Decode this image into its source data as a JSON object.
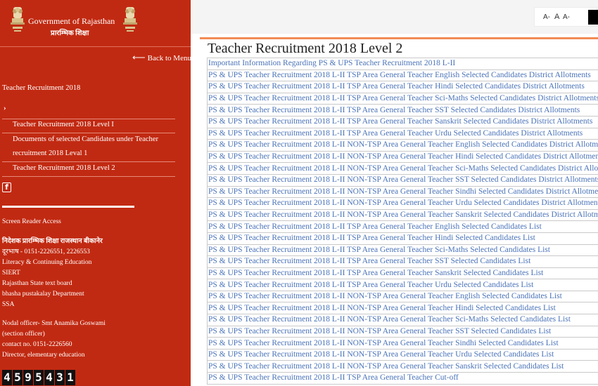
{
  "brand": {
    "title": "Government of Rajasthan",
    "subtitle": "प्रारम्भिक शिक्षा"
  },
  "sidebar": {
    "back_label": "Back to Menu",
    "section_title": "Teacher Recruitment 2018",
    "chevron": "›",
    "menu_items": [
      "Teacher Recruitment 2018 Level I",
      "Documents of selected Candidates under Teacher",
      "recruitment 2018 Leval 1",
      "Teacher Recruitment 2018 Level 2"
    ],
    "facebook_glyph": "f",
    "screen_reader": "Screen Reader Access",
    "office_name": "निदेशक प्रारम्भिक शिक्षा राजस्थान बीकानेर",
    "phone": "दूरभाष - 0151-2226551, 2226553",
    "links": [
      "Literacy & Continuing Education",
      "SIERT",
      "Rajasthan State text board",
      " bhasha pustakalay Department",
      "SSA"
    ],
    "nodal_officer": "Nodal officer- Smt Anamika Goswami",
    "section_officer": "(section officer)",
    "contact": "contact no. 0151-2226560",
    "director": "Director, elementary education",
    "visitor_count": "4595431"
  },
  "topbar": {
    "font_small": "A-",
    "font_normal": "A",
    "font_large": "A-"
  },
  "main": {
    "title": "Teacher Recruitment 2018 Level 2",
    "links": [
      "Important Information Regarding PS & UPS Teacher Recruitment 2018 L-II",
      "PS & UPS Teacher Recruitment 2018 L-II TSP Area General Teacher English Selected Candidates District Allotments",
      "PS & UPS Teacher Recruitment 2018 L-II TSP Area General Teacher Hindi Selected Candidates District Allotments",
      "PS & UPS Teacher Recruitment 2018 L-II TSP Area General Teacher Sci-Maths Selected Candidates District Allotments",
      "PS & UPS Teacher Recruitment 2018 L-II TSP Area General Teacher SST Selected Candidates District Allotments",
      "PS & UPS Teacher Recruitment 2018 L-II TSP Area General Teacher Sanskrit Selected Candidates District Allotments",
      "PS & UPS Teacher Recruitment 2018 L-II TSP Area General Teacher Urdu Selected Candidates District Allotments",
      "PS & UPS Teacher Recruitment 2018 L-II NON-TSP Area General Teacher English Selected Candidates District Allotments",
      "PS & UPS Teacher Recruitment 2018 L-II NON-TSP Area General Teacher Hindi Selected Candidates District Allotments",
      "PS & UPS Teacher Recruitment 2018 L-II NON-TSP Area General Teacher Sci-Maths Selected Candidates District Allotments",
      "PS & UPS Teacher Recruitment 2018 L-II NON-TSP Area General Teacher SST Selected Candidates District Allotments",
      "PS & UPS Teacher Recruitment 2018 L-II NON-TSP Area General Teacher Sindhi Selected Candidates District Allotments",
      "PS & UPS Teacher Recruitment 2018 L-II NON-TSP Area General Teacher Urdu Selected Candidates District Allotments",
      "PS & UPS Teacher Recruitment 2018 L-II NON-TSP Area General Teacher Sanskrit Selected Candidates District Allotments",
      "PS & UPS Teacher Recruitment 2018 L-II TSP Area General Teacher English Selected Candidates List",
      "PS & UPS Teacher Recruitment 2018 L-II TSP Area General Teacher Hindi Selected Candidates List",
      "PS & UPS Teacher Recruitment 2018 L-II TSP Area General Teacher Sci-Maths Selected Candidates List",
      "PS & UPS Teacher Recruitment 2018 L-II TSP Area General Teacher SST Selected Candidates List",
      "PS & UPS Teacher Recruitment 2018 L-II TSP Area General Teacher Sanskrit Selected Candidates List",
      "PS & UPS Teacher Recruitment 2018 L-II TSP Area General Teacher Urdu Selected Candidates List",
      "PS & UPS Teacher Recruitment 2018 L-II NON-TSP Area General Teacher English Selected Candidates List",
      "PS & UPS Teacher Recruitment 2018 L-II NON-TSP Area General Teacher Hindi Selected Candidates List",
      "PS & UPS Teacher Recruitment 2018 L-II NON-TSP Area General Teacher Sci-Maths Selected Candidates List",
      "PS & UPS Teacher Recruitment 2018 L-II NON-TSP Area General Teacher SST Selected Candidates List",
      "PS & UPS Teacher Recruitment 2018 L-II NON-TSP Area General Teacher Sindhi Selected Candidates List",
      "PS & UPS Teacher Recruitment 2018 L-II NON-TSP Area General Teacher Urdu Selected Candidates List",
      "PS & UPS Teacher Recruitment 2018 L-II NON-TSP Area General Teacher Sanskrit Selected Candidates List",
      "PS & UPS Teacher Recruitment 2018 L-II TSP Area General Teacher Cut-off"
    ]
  },
  "colors": {
    "sidebar_bg": "#c12a12",
    "accent_orange": "#f28b54",
    "link_blue": "#4a73b8"
  }
}
